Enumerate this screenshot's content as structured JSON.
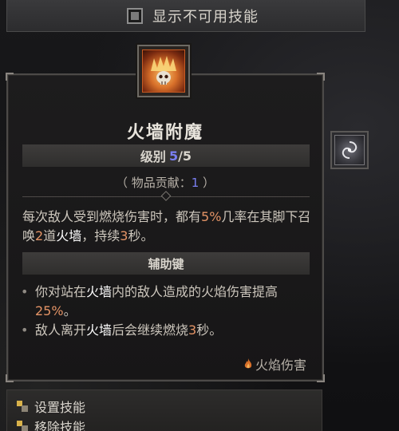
{
  "top_bar": {
    "label": "显示不可用技能"
  },
  "tooltip": {
    "title": "火墙附魔",
    "rank_label": "级别",
    "rank_current": "5",
    "rank_sep": "/",
    "rank_max": "5",
    "item_contrib_prefix": "（ 物品贡献：",
    "item_contrib_value": "1",
    "item_contrib_suffix": " ）",
    "description": {
      "part1": "每次敌人受到燃烧伤害时，都有",
      "chance": "5%",
      "part2": "几率在其脚下召唤",
      "count": "2",
      "part3": "道",
      "keyword": "火墙",
      "part4": "，持续",
      "duration": "3",
      "part5": "秒。"
    },
    "modifier_header": "辅助键",
    "bullets": [
      {
        "pre": "你对站在",
        "keyword": "火墙",
        "mid": "内的敌人造成的火焰伤害提高",
        "value": "25%",
        "post": "。"
      },
      {
        "pre": "敌人离开",
        "keyword": "火墙",
        "mid": "后会继续燃烧",
        "value": "3",
        "post": "秒。"
      }
    ],
    "damage_tag": "火焰伤害"
  },
  "menu": {
    "items": [
      {
        "label": "设置技能",
        "icon": "key-icon"
      },
      {
        "label": "移除技能",
        "icon": "key-icon"
      }
    ]
  },
  "colors": {
    "accent_blue": "#7a7ff2",
    "highlight_orange": "#e49466",
    "fire": "#d8702a"
  }
}
